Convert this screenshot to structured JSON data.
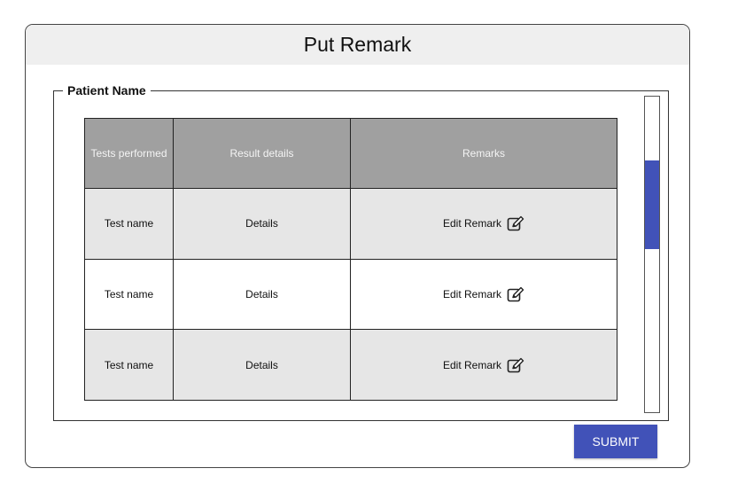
{
  "dialog": {
    "title": "Put Remark",
    "fieldset_legend": "Patient Name",
    "submit_label": "SUBMIT"
  },
  "table": {
    "columns": [
      "Tests performed",
      "Result details",
      "Remarks"
    ],
    "rows": [
      {
        "test": "Test name",
        "result": "Details",
        "remark_action": "Edit Remark"
      },
      {
        "test": "Test name",
        "result": "Details",
        "remark_action": "Edit Remark"
      },
      {
        "test": "Test name",
        "result": "Details",
        "remark_action": "Edit Remark"
      }
    ]
  },
  "icons": {
    "edit": "edit-icon"
  },
  "colors": {
    "accent": "#4152b8",
    "header_bg": "#a0a0a0",
    "row_shaded": "#e6e6e6",
    "title_bar_bg": "#efefef"
  }
}
